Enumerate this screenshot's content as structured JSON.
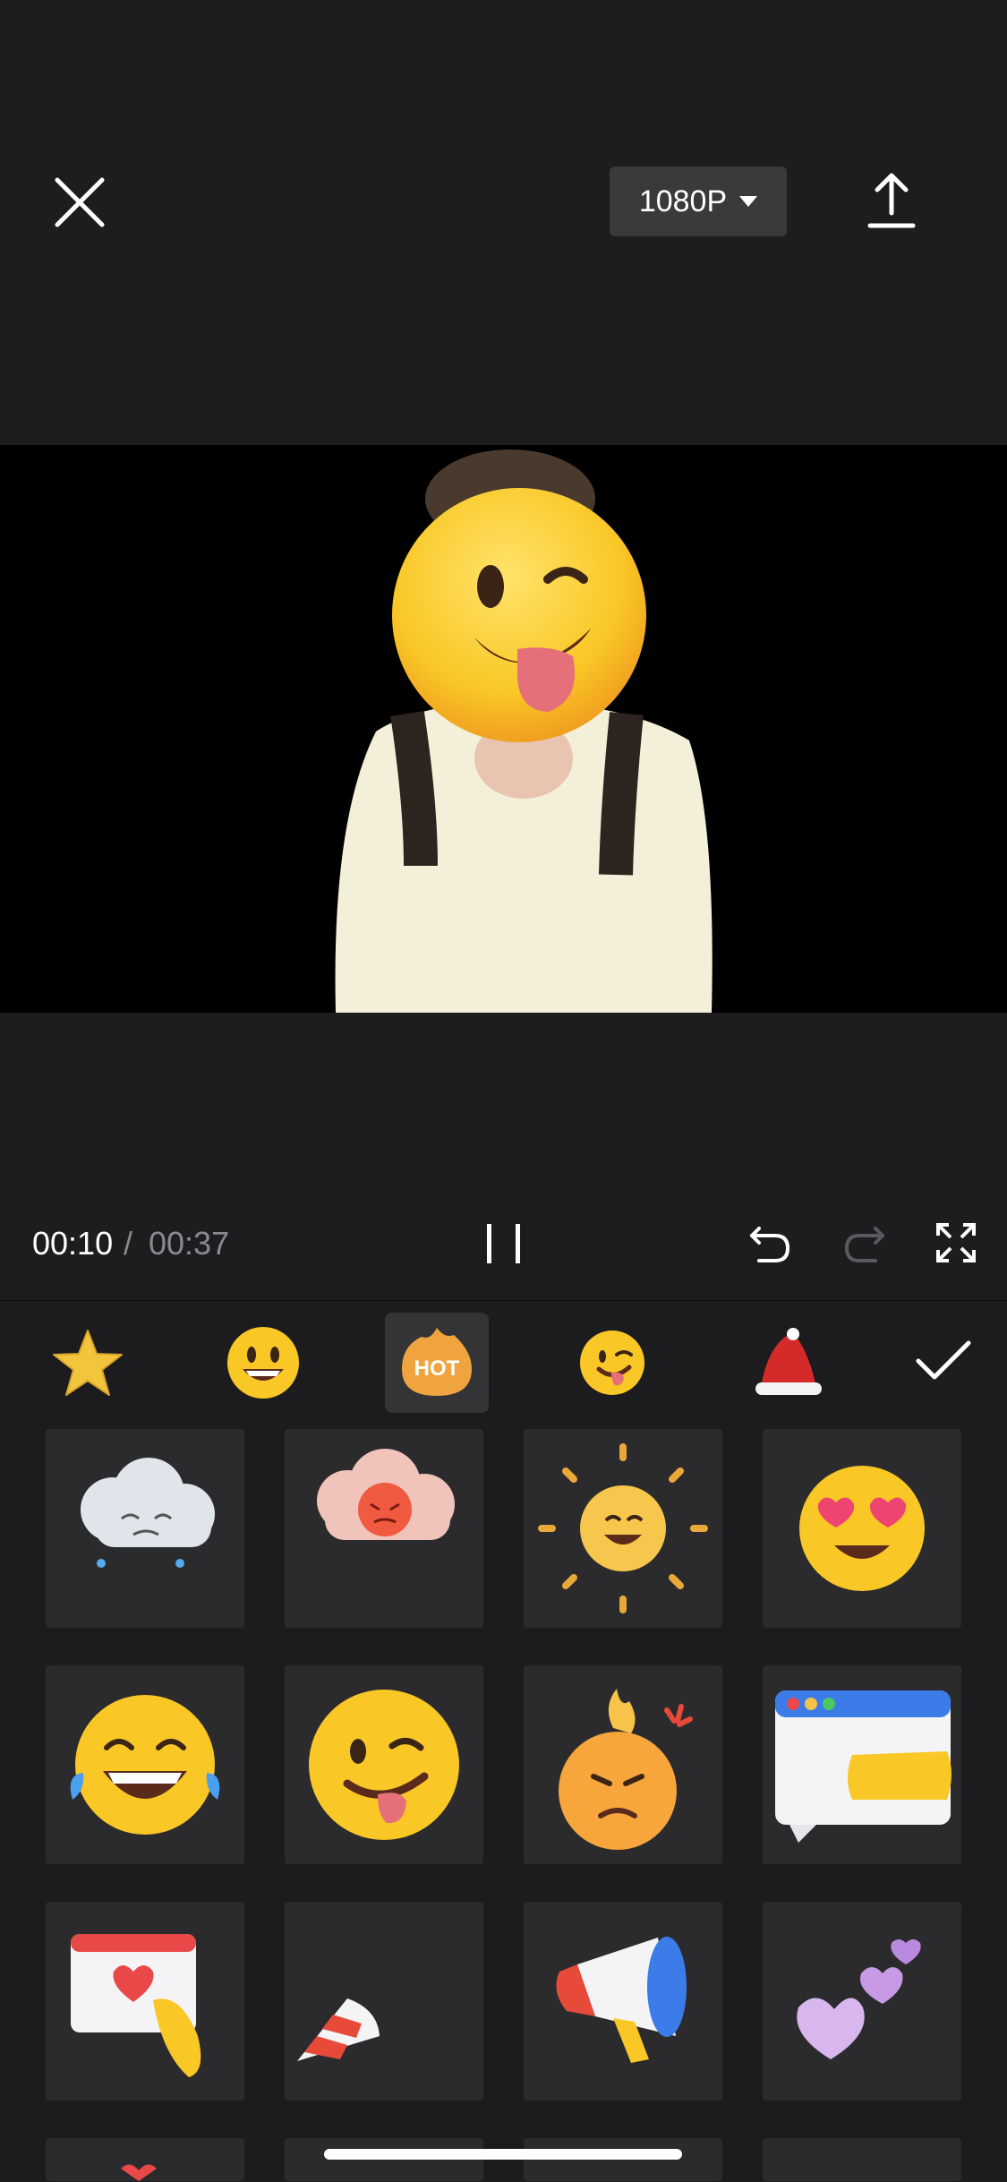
{
  "toolbar": {
    "resolution_label": "1080P",
    "icons": [
      "close-icon",
      "chevron-down-icon",
      "export-icon"
    ]
  },
  "playback": {
    "current_time": "00:10",
    "separator": "/",
    "total_time": "00:37"
  },
  "sticker_tabs": [
    {
      "name": "favorites",
      "icon": "star-icon"
    },
    {
      "name": "emoji",
      "icon": "grinning-face-icon"
    },
    {
      "name": "hot",
      "label": "HOT",
      "active": true
    },
    {
      "name": "wink",
      "icon": "winking-tongue-face-icon"
    },
    {
      "name": "christmas",
      "icon": "santa-hat-icon"
    }
  ],
  "stickers": [
    "sad-cloud-sticker",
    "angry-cloud-sticker",
    "sun-smile-sticker",
    "heart-eyes-sticker",
    "tears-of-joy-sticker",
    "wink-tongue-sticker",
    "angry-fire-sticker",
    "browser-hand-sticker",
    "heart-browser-sticker",
    "party-popper-sticker",
    "megaphone-sticker",
    "hearts-sticker"
  ],
  "colors": {
    "background": "#1d1d1f",
    "panel": "#1c1c1e",
    "accent_hot": "#f0a440",
    "emoji_yellow": "#f9c726"
  }
}
